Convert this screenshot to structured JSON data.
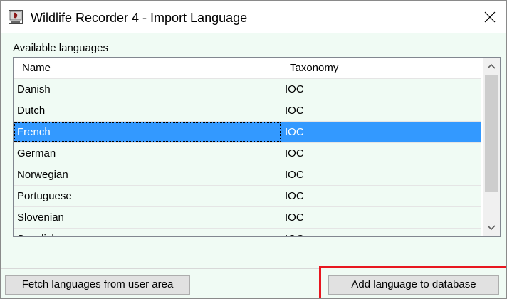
{
  "window": {
    "title": "Wildlife Recorder 4 - Import Language",
    "app_icon": "wildlife-recorder-app-icon",
    "close_icon": "close-icon"
  },
  "languages_section": {
    "label": "Available languages",
    "columns": [
      "Name",
      "Taxonomy"
    ],
    "rows": [
      {
        "name": "Danish",
        "taxonomy": "IOC"
      },
      {
        "name": "Dutch",
        "taxonomy": "IOC"
      },
      {
        "name": "French",
        "taxonomy": "IOC",
        "selected": true
      },
      {
        "name": "German",
        "taxonomy": "IOC"
      },
      {
        "name": "Norwegian",
        "taxonomy": "IOC"
      },
      {
        "name": "Portuguese",
        "taxonomy": "IOC"
      },
      {
        "name": "Slovenian",
        "taxonomy": "IOC"
      },
      {
        "name": "Swedish",
        "taxonomy": "IOC"
      }
    ]
  },
  "buttons": {
    "fetch_label": "Fetch languages from user area",
    "add_label": "Add language to database"
  },
  "colors": {
    "selection": "#3399ff",
    "highlight_frame": "#e8161f",
    "row_background": "#f0fbf4"
  }
}
